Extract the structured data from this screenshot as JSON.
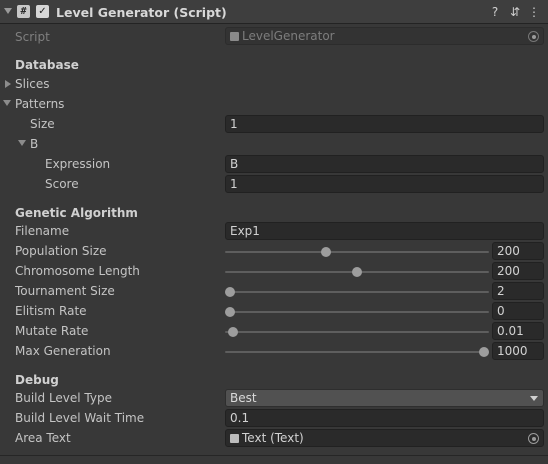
{
  "header": {
    "title": "Level Generator (Script)",
    "icons": [
      "help-icon",
      "preset-icon",
      "more-menu-icon"
    ]
  },
  "script": {
    "label": "Script",
    "value": "LevelGenerator"
  },
  "database": {
    "heading": "Database",
    "slices_label": "Slices",
    "patterns_label": "Patterns",
    "size_label": "Size",
    "size_value": "1",
    "b_label": "B",
    "expression_label": "Expression",
    "expression_value": "B",
    "score_label": "Score",
    "score_value": "1"
  },
  "ga": {
    "heading": "Genetic Algorithm",
    "filename_label": "Filename",
    "filename_value": "Exp1",
    "sliders": [
      {
        "label": "Population Size",
        "value": "200",
        "fraction": 0.378
      },
      {
        "label": "Chromosome Length",
        "value": "200",
        "fraction": 0.5
      },
      {
        "label": "Tournament Size",
        "value": "2",
        "fraction": 0.0
      },
      {
        "label": "Elitism Rate",
        "value": "0",
        "fraction": 0.0
      },
      {
        "label": "Mutate Rate",
        "value": "0.01",
        "fraction": 0.01
      },
      {
        "label": "Max Generation",
        "value": "1000",
        "fraction": 1.0
      }
    ]
  },
  "debug": {
    "heading": "Debug",
    "build_type_label": "Build Level Type",
    "build_type_value": "Best",
    "wait_label": "Build Level Wait Time",
    "wait_value": "0.1",
    "area_label": "Area Text",
    "area_value": "Text (Text)"
  }
}
